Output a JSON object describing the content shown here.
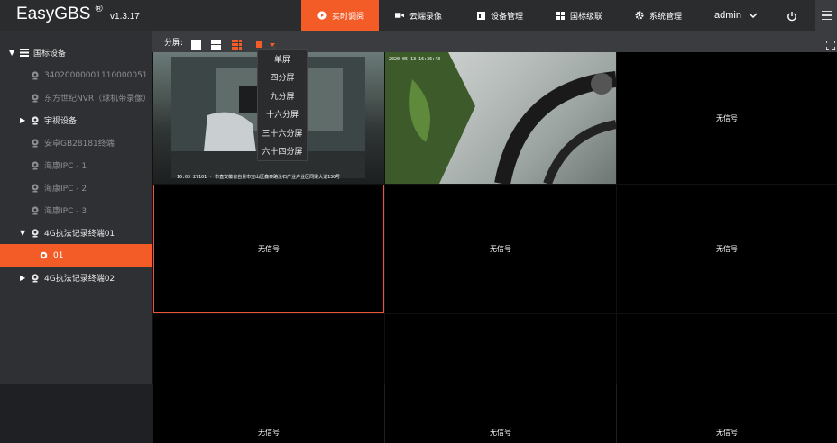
{
  "header": {
    "brand": "EasyGBS",
    "brand_mark": "®",
    "version": "v1.3.17",
    "nav": [
      {
        "label": "实时调阅",
        "icon": "play-circle-icon",
        "active": true
      },
      {
        "label": "云端录像",
        "icon": "video-camera-icon",
        "active": false
      },
      {
        "label": "设备管理",
        "icon": "device-list-icon",
        "active": false
      },
      {
        "label": "国标级联",
        "icon": "grid-icon",
        "active": false
      },
      {
        "label": "系统管理",
        "icon": "gear-icon",
        "active": false
      }
    ],
    "user": "admin"
  },
  "sidebar": {
    "items": [
      {
        "label": "国标设备",
        "icon": "list-icon",
        "expanded": true
      },
      {
        "label": "34020000001110000051",
        "icon": "camera-icon"
      },
      {
        "label": "东方世纪NVR（球机带录像）",
        "icon": "camera-icon"
      },
      {
        "label": "宇视设备",
        "icon": "camera-icon",
        "expanded": false
      },
      {
        "label": "安卓GB28181终端",
        "icon": "camera-icon"
      },
      {
        "label": "海康IPC - 1",
        "icon": "camera-icon"
      },
      {
        "label": "海康IPC - 2",
        "icon": "camera-icon"
      },
      {
        "label": "海康IPC - 3",
        "icon": "camera-icon"
      },
      {
        "label": "4G执法记录终端01",
        "icon": "camera-icon",
        "expanded": true
      },
      {
        "label": "01",
        "icon": "channel-icon",
        "selected": true
      },
      {
        "label": "4G执法记录终端02",
        "icon": "camera-icon",
        "expanded": false
      }
    ]
  },
  "toolbar": {
    "split_label": "分屏:"
  },
  "layout_menu": {
    "options": [
      "单屏",
      "四分屏",
      "九分屏",
      "十六分屏",
      "三十六分屏",
      "六十四分屏"
    ]
  },
  "video_grid": {
    "cells": [
      {
        "status": "",
        "osd_top": "",
        "osd_bottom": "16:03 27101 · 市直安徽省自贵市宝山区鑫泰路汝石产业户业区同梁大道130号"
      },
      {
        "status": "",
        "osd_top": "2020-05-13 16:36:43",
        "osd_bottom": ""
      },
      {
        "status": "无信号"
      },
      {
        "status": "无信号"
      },
      {
        "status": "无信号"
      },
      {
        "status": "无信号"
      },
      {
        "status": "无信号"
      },
      {
        "status": "无信号"
      },
      {
        "status": "无信号"
      }
    ]
  },
  "colors": {
    "accent": "#f35b27",
    "topbar": "#2b2c2e",
    "sidebar": "#2e3033",
    "toolbar": "#3a3c3f"
  }
}
